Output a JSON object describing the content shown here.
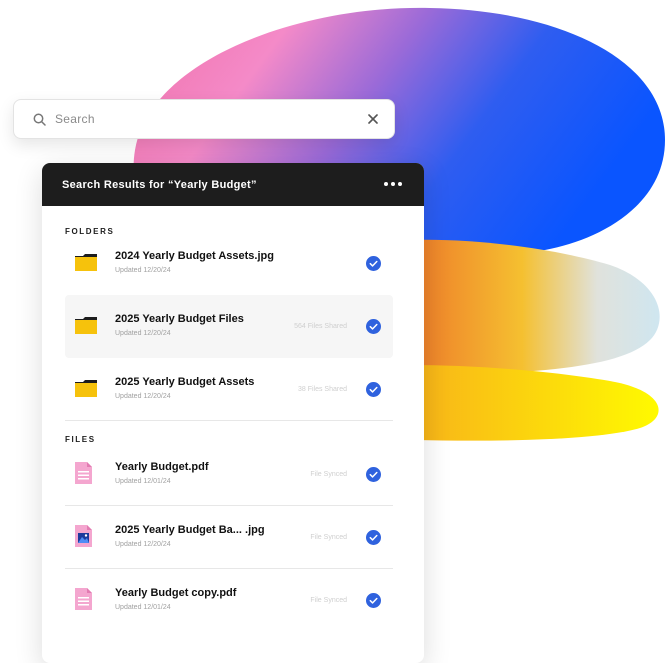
{
  "search": {
    "placeholder": "Search"
  },
  "panel": {
    "title": "Search Results for “Yearly Budget”"
  },
  "sections": {
    "folders": "FOLDERS",
    "files": "FILES"
  },
  "folders": [
    {
      "name": "2024 Yearly Budget Assets.jpg",
      "updated": "Updated 12/20/24",
      "status": ""
    },
    {
      "name": "2025 Yearly Budget Files",
      "updated": "Updated 12/20/24",
      "status": "564 Files Shared"
    },
    {
      "name": "2025 Yearly Budget Assets",
      "updated": "Updated 12/20/24",
      "status": "38 Files Shared"
    }
  ],
  "files": [
    {
      "name": "Yearly Budget.pdf",
      "updated": "Updated 12/01/24",
      "status": "File Synced",
      "icon": "pdf-file-icon"
    },
    {
      "name": "2025 Yearly Budget Ba... .jpg",
      "updated": "Updated 12/20/24",
      "status": "File Synced",
      "icon": "image-file-icon"
    },
    {
      "name": "Yearly Budget copy.pdf",
      "updated": "Updated 12/01/24",
      "status": "File Synced",
      "icon": "pdf-file-icon"
    }
  ],
  "colors": {
    "header_bg": "#1d1d1d",
    "check_blue": "#2f62de",
    "folder_yellow": "#f6c20c",
    "file_pink": "#f4a6cf"
  }
}
